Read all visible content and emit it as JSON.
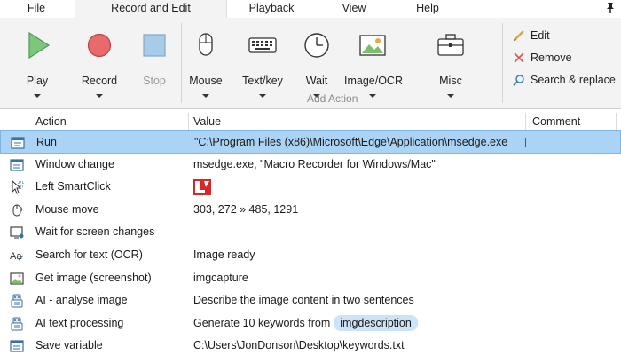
{
  "menu": {
    "tabs": [
      {
        "label": "File"
      },
      {
        "label": "Record and Edit"
      },
      {
        "label": "Playback"
      },
      {
        "label": "View"
      },
      {
        "label": "Help"
      }
    ]
  },
  "ribbon": {
    "buttons": {
      "play": "Play",
      "record": "Record",
      "stop": "Stop",
      "mouse": "Mouse",
      "textkey": "Text/key",
      "wait": "Wait",
      "imageocr": "Image/OCR",
      "misc": "Misc"
    },
    "group_label": "Add Action",
    "side": {
      "edit": "Edit",
      "remove": "Remove",
      "search": "Search & replace"
    }
  },
  "table": {
    "columns": {
      "action": "Action",
      "value": "Value",
      "comment": "Comment"
    },
    "rows": [
      {
        "icon": "run-icon",
        "action": "Run",
        "value": "\"C:\\Program Files (x86)\\Microsoft\\Edge\\Application\\msedge.exe"
      },
      {
        "icon": "window-icon",
        "action": "Window change",
        "value": "msedge.exe, \"Macro Recorder for Windows/Mac\""
      },
      {
        "icon": "smartclick-icon",
        "action": "Left SmartClick",
        "value": ""
      },
      {
        "icon": "mouse-move-icon",
        "action": "Mouse move",
        "value": "303, 272 » 485, 1291"
      },
      {
        "icon": "wait-screen-icon",
        "action": "Wait for screen changes",
        "value": ""
      },
      {
        "icon": "ocr-icon",
        "action": "Search for text (OCR)",
        "value": "Image ready"
      },
      {
        "icon": "screenshot-icon",
        "action": "Get image (screenshot)",
        "value": "imgcapture"
      },
      {
        "icon": "ai-icon",
        "action": "AI - analyse image",
        "value": "Describe the image content in two sentences"
      },
      {
        "icon": "ai-icon",
        "action": "AI text processing",
        "value": "Generate 10 keywords from",
        "chip": "imgdescription"
      },
      {
        "icon": "save-variable-icon",
        "action": "Save variable",
        "value": "C:\\Users\\JonDonson\\Desktop\\keywords.txt"
      }
    ]
  },
  "colors": {
    "selected_row": "#abd3f6",
    "play_green": "#7cc77c",
    "record_red": "#e86a6a",
    "stop_blue": "#a8cbe8",
    "chip": "#cfe3f7"
  }
}
